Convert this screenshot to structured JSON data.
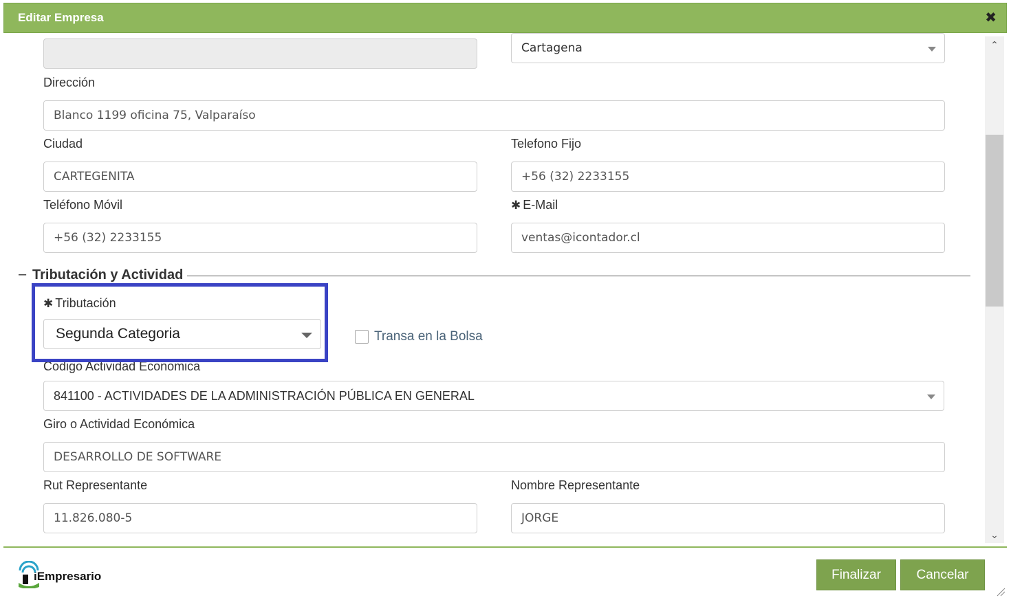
{
  "dialog": {
    "title": "Editar Empresa",
    "close_symbol": "✖"
  },
  "form": {
    "top_left_value": "",
    "top_right_select": "Cartagena",
    "direccion_label": "Dirección",
    "direccion_value": "Blanco 1199 oficina 75, Valparaíso",
    "ciudad_label": "Ciudad",
    "ciudad_value": "CARTEGENITA",
    "telefono_fijo_label": "Telefono Fijo",
    "telefono_fijo_value": " +56 (32) 2233155",
    "telefono_movil_label": "Teléfono Móvil",
    "telefono_movil_value": "+56 (32) 2233155",
    "email_label": "E-Mail",
    "email_value": "ventas@icontador.cl",
    "required_symbol": "✱"
  },
  "section": {
    "dash": "–",
    "title": "Tributación y Actividad",
    "tributacion_label": "Tributación",
    "tributacion_value": "Segunda Categoria",
    "bolsa_label": "Transa en la Bolsa",
    "bolsa_checked": false,
    "codigo_label": "Codigo Actividad Economica",
    "codigo_value": "841100 - ACTIVIDADES DE LA ADMINISTRACIÓN PÚBLICA EN GENERAL",
    "giro_label": "Giro o Actividad Económica",
    "giro_value": "DESARROLLO DE SOFTWARE",
    "rut_label": "Rut Representante",
    "rut_value": "11.826.080-5",
    "nombre_label": "Nombre Representante",
    "nombre_value": "JORGE"
  },
  "footer": {
    "logo_text": "iEmpresario",
    "finalizar_label": "Finalizar",
    "cancelar_label": "Cancelar"
  },
  "colors": {
    "header_green": "#8fb75c",
    "button_green": "#7ea34e",
    "highlight_blue": "#3a43c4"
  }
}
